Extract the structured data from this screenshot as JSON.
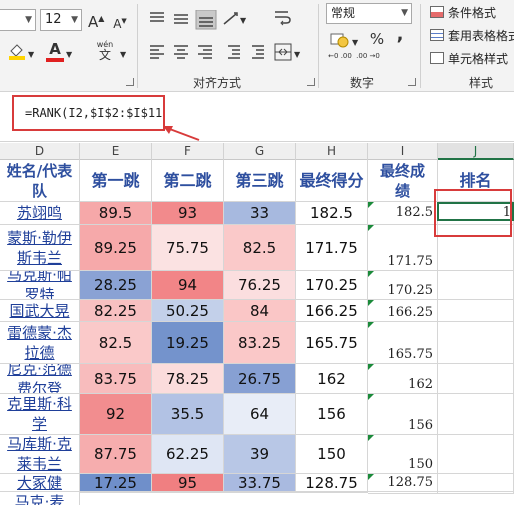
{
  "ribbon": {
    "font_size": "12",
    "grow_font": "A",
    "shrink_font": "A",
    "fill_label": "",
    "font_color_label": "A",
    "phonetic_label": "wén",
    "phonetic_char": "文",
    "alignment_group": "对齐方式",
    "number_format": "常规",
    "currency": "¥",
    "percent": "%",
    "comma": ",",
    "inc_decimal": "←0 .00",
    "dec_decimal": ".00 →0",
    "number_group": "数字",
    "styles": [
      "条件格式",
      "套用表格格式",
      "单元格样式"
    ],
    "styles_group": "样式"
  },
  "formula": "=RANK(I2,$I$2:$I$11)",
  "columns": [
    "D",
    "E",
    "F",
    "G",
    "H",
    "I",
    "J"
  ],
  "headers": {
    "d": "姓名/代表队",
    "e": "第一跳",
    "f": "第二跳",
    "g": "第三跳",
    "h": "最终得分",
    "i": "最终成绩",
    "j": "排名"
  },
  "rows": [
    {
      "name": "苏翊鸣",
      "e": "89.5",
      "f": "93",
      "g": "33",
      "h": "182.5",
      "i": "182.5",
      "j": "1"
    },
    {
      "name": "蒙斯·勒伊斯韦兰",
      "e": "89.25",
      "f": "75.75",
      "g": "82.5",
      "h": "171.75",
      "i": "171.75",
      "j": ""
    },
    {
      "name": "马克斯·帕罗特",
      "e": "28.25",
      "f": "94",
      "g": "76.25",
      "h": "170.25",
      "i": "170.25",
      "j": ""
    },
    {
      "name": "国武大晃",
      "e": "82.25",
      "f": "50.25",
      "g": "84",
      "h": "166.25",
      "i": "166.25",
      "j": ""
    },
    {
      "name": "雷德蒙·杰拉德",
      "e": "82.5",
      "f": "19.25",
      "g": "83.25",
      "h": "165.75",
      "i": "165.75",
      "j": ""
    },
    {
      "name": "尼克·范德费尔登",
      "e": "83.75",
      "f": "78.25",
      "g": "26.75",
      "h": "162",
      "i": "162",
      "j": ""
    },
    {
      "name": "克里斯·科学",
      "e": "92",
      "f": "35.5",
      "g": "64",
      "h": "156",
      "i": "156",
      "j": ""
    },
    {
      "name": "马库斯·克莱韦兰",
      "e": "87.75",
      "f": "62.25",
      "g": "39",
      "h": "150",
      "i": "150",
      "j": ""
    },
    {
      "name": "大冢健",
      "e": "17.25",
      "f": "95",
      "g": "33.75",
      "h": "128.75",
      "i": "128.75",
      "j": ""
    },
    {
      "name": "马克·麦",
      "e": "",
      "f": "",
      "g": "",
      "h": "",
      "i": "",
      "j": ""
    }
  ],
  "colors": {
    "accent_red": "#d83b3b",
    "header_text": "#2e4f9f",
    "heat": {
      "89.5": "#f6a8a9",
      "93": "#f28a8c",
      "33": "#a7b9df",
      "89.25": "#f6a9aa",
      "75.75": "#fbe2e2",
      "82.5": "#fac9c9",
      "28.25": "#8aa2d4",
      "94": "#f28587",
      "76.25": "#fbdedf",
      "82.25": "#f8c0c1",
      "50.25": "#c3d0ea",
      "84": "#fac6c6",
      "19.25": "#7493cc",
      "83.25": "#fac8c8",
      "83.75": "#f8bcbd",
      "78.25": "#fbdcdc",
      "26.75": "#87a0d3",
      "92": "#f28d8f",
      "35.5": "#b2c2e4",
      "64": "#e8edf7",
      "87.75": "#f6adae",
      "62.25": "#dfe6f4",
      "39": "#b8c7e6",
      "17.25": "#6f8fca",
      "95": "#f07f81",
      "33.75": "#a9bae0"
    }
  }
}
